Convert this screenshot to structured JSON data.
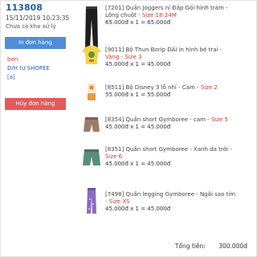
{
  "order": {
    "id": "113808",
    "datetime": "15/11/2019 10:23:35",
    "status": "Chưa có kho xử lý",
    "print_label": "In đơn hàng",
    "user": "ben",
    "source": "D/H từ SHOPEE",
    "tag": "[a]",
    "cancel_label": "Hủy đơn hàng"
  },
  "items": [
    {
      "code_name": "[7201] Quần Joggers nỉ Đắp Gối hình trám -",
      "variant_prefix": "Lông chuột",
      "variant": " - Size 18-24M",
      "price_line": "65.000đ x 1 = 65.000đ",
      "thumb_icon": "black-joggers-icon"
    },
    {
      "code_name": "[9011] Bộ Thun Borip DÀI in hình bé trai -",
      "variant_prefix": "",
      "variant": "Vàng - Size 3",
      "price_line": "45.000đ x 1 = 45.000đ",
      "thumb_icon": "yellow-bodysuit-icon"
    },
    {
      "code_name": "[8511] Bộ Disney 3 lỗ nhí - Cam -",
      "variant_prefix": "",
      "variant": "Size 2",
      "price_line": "55.000đ x 1 = 55.000đ",
      "thumb_icon": "orange-disney-set-icon"
    },
    {
      "code_name": "[8354] Quần short Gymboree - cam -",
      "variant_prefix": "",
      "variant": "Size 5",
      "price_line": "45.000đ x 1 = 45.000đ",
      "thumb_icon": "shorts-icon"
    },
    {
      "code_name": "[8351] Quần short Gymboree - Xanh da trời -",
      "variant_prefix": "",
      "variant": "Size 6",
      "price_line": "45.000đ x 1 = 45.000đ",
      "thumb_icon": "blue-shorts-icon"
    },
    {
      "code_name": "[7498] Quần legging Gymboree - Ngôi sao tím",
      "variant_prefix": "",
      "variant": "- Size XS",
      "price_line": "45.000đ x 1 = 45.000đ",
      "thumb_icon": "purple-legging-icon"
    }
  ],
  "summary": {
    "total_label": "Tổng tiền:",
    "total_value": "300.000đ"
  }
}
